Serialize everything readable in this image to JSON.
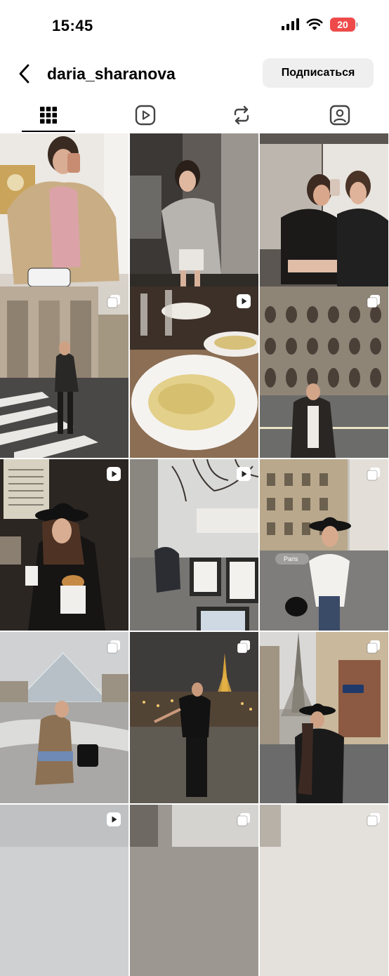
{
  "status_bar": {
    "time": "15:45",
    "battery": "20",
    "icons": [
      "signal-icon",
      "wifi-icon",
      "battery-icon"
    ]
  },
  "header": {
    "back_icon": "chevron-left-icon",
    "username": "daria_sharanova",
    "follow_label": "Подписаться"
  },
  "tabs": [
    {
      "name": "grid-icon",
      "active": true
    },
    {
      "name": "reels-icon",
      "active": false
    },
    {
      "name": "reposts-icon",
      "active": false
    },
    {
      "name": "tagged-icon",
      "active": false
    }
  ],
  "posts": [
    {
      "badge": "none"
    },
    {
      "badge": "none"
    },
    {
      "badge": "none"
    },
    {
      "badge": "carousel"
    },
    {
      "badge": "reel"
    },
    {
      "badge": "carousel"
    },
    {
      "badge": "reel"
    },
    {
      "badge": "reel"
    },
    {
      "badge": "carousel",
      "location_tag": "Paris"
    },
    {
      "badge": "carousel"
    },
    {
      "badge": "carousel"
    },
    {
      "badge": "carousel"
    },
    {
      "badge": "reel"
    },
    {
      "badge": "carousel"
    },
    {
      "badge": "carousel"
    }
  ],
  "colors": {
    "battery": "#ef4a4a",
    "follow_button_bg": "#efefef",
    "active_tab_indicator": "#000000"
  }
}
